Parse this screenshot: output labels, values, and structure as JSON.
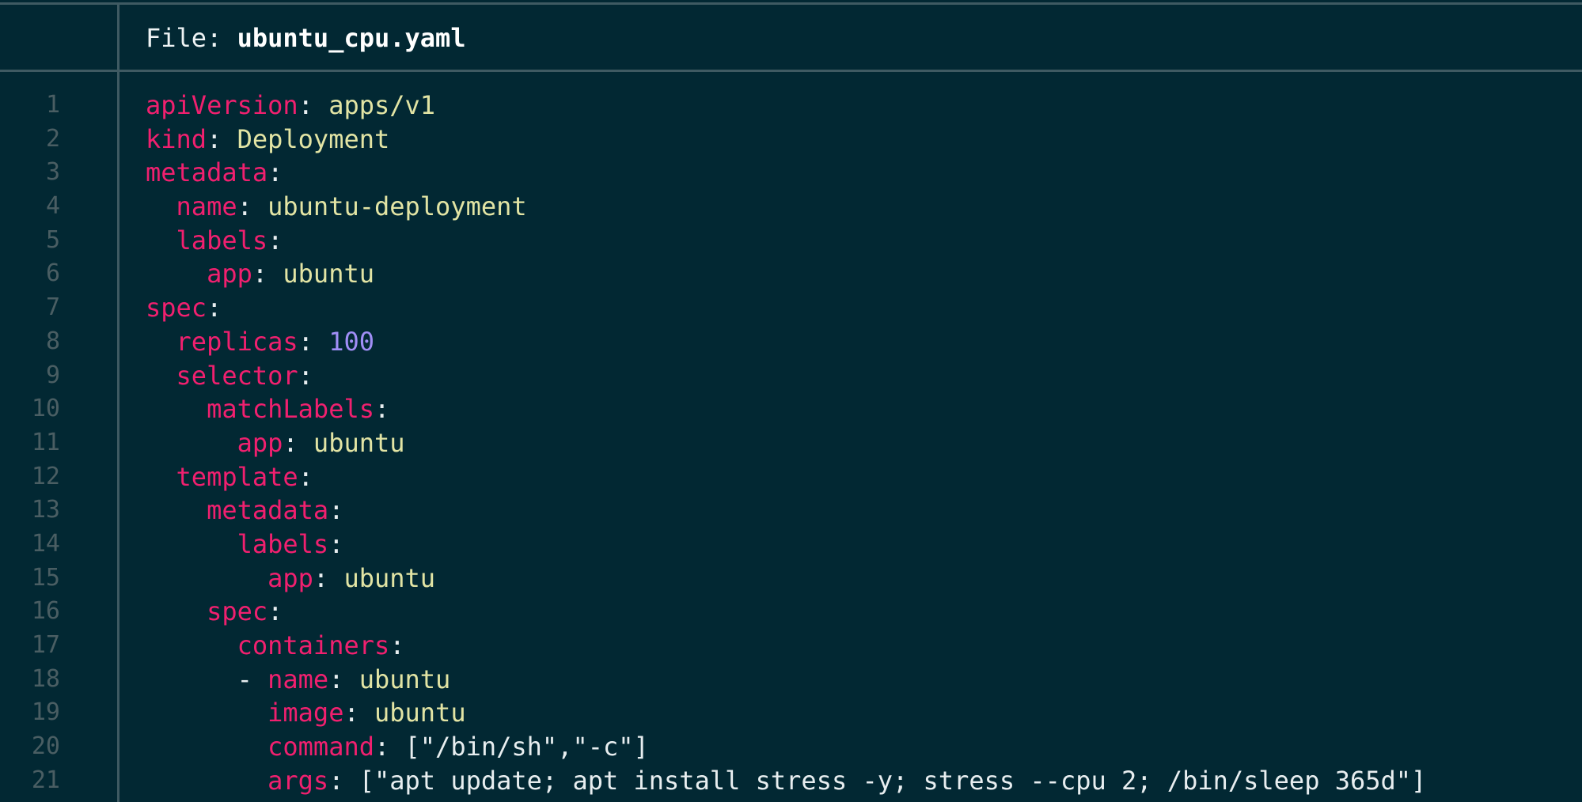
{
  "header": {
    "prefix": "File: ",
    "filename": "ubuntu_cpu.yaml"
  },
  "colors": {
    "background": "#022833",
    "key": "#f0206f",
    "value": "#e2e4a4",
    "number": "#a08ef6",
    "line_number": "#4a5e63",
    "divider": "#3f5a62"
  },
  "lines": [
    {
      "num": "1",
      "indent": "",
      "dash": "",
      "key": "apiVersion",
      "sep": ": ",
      "val": "apps/v1",
      "valType": "s"
    },
    {
      "num": "2",
      "indent": "",
      "dash": "",
      "key": "kind",
      "sep": ": ",
      "val": "Deployment",
      "valType": "s"
    },
    {
      "num": "3",
      "indent": "",
      "dash": "",
      "key": "metadata",
      "sep": ":",
      "val": "",
      "valType": "s"
    },
    {
      "num": "4",
      "indent": "  ",
      "dash": "",
      "key": "name",
      "sep": ": ",
      "val": "ubuntu-deployment",
      "valType": "s"
    },
    {
      "num": "5",
      "indent": "  ",
      "dash": "",
      "key": "labels",
      "sep": ":",
      "val": "",
      "valType": "s"
    },
    {
      "num": "6",
      "indent": "    ",
      "dash": "",
      "key": "app",
      "sep": ": ",
      "val": "ubuntu",
      "valType": "s"
    },
    {
      "num": "7",
      "indent": "",
      "dash": "",
      "key": "spec",
      "sep": ":",
      "val": "",
      "valType": "s"
    },
    {
      "num": "8",
      "indent": "  ",
      "dash": "",
      "key": "replicas",
      "sep": ": ",
      "val": "100",
      "valType": "n"
    },
    {
      "num": "9",
      "indent": "  ",
      "dash": "",
      "key": "selector",
      "sep": ":",
      "val": "",
      "valType": "s"
    },
    {
      "num": "10",
      "indent": "    ",
      "dash": "",
      "key": "matchLabels",
      "sep": ":",
      "val": "",
      "valType": "s"
    },
    {
      "num": "11",
      "indent": "      ",
      "dash": "",
      "key": "app",
      "sep": ": ",
      "val": "ubuntu",
      "valType": "s"
    },
    {
      "num": "12",
      "indent": "  ",
      "dash": "",
      "key": "template",
      "sep": ":",
      "val": "",
      "valType": "s"
    },
    {
      "num": "13",
      "indent": "    ",
      "dash": "",
      "key": "metadata",
      "sep": ":",
      "val": "",
      "valType": "s"
    },
    {
      "num": "14",
      "indent": "      ",
      "dash": "",
      "key": "labels",
      "sep": ":",
      "val": "",
      "valType": "s"
    },
    {
      "num": "15",
      "indent": "        ",
      "dash": "",
      "key": "app",
      "sep": ": ",
      "val": "ubuntu",
      "valType": "s"
    },
    {
      "num": "16",
      "indent": "    ",
      "dash": "",
      "key": "spec",
      "sep": ":",
      "val": "",
      "valType": "s"
    },
    {
      "num": "17",
      "indent": "      ",
      "dash": "",
      "key": "containers",
      "sep": ":",
      "val": "",
      "valType": "s"
    },
    {
      "num": "18",
      "indent": "      ",
      "dash": "- ",
      "key": "name",
      "sep": ": ",
      "val": "ubuntu",
      "valType": "s"
    },
    {
      "num": "19",
      "indent": "        ",
      "dash": "",
      "key": "image",
      "sep": ": ",
      "val": "ubuntu",
      "valType": "s"
    },
    {
      "num": "20",
      "indent": "        ",
      "dash": "",
      "key": "command",
      "sep": ": ",
      "val": "[\"/bin/sh\",\"-c\"]",
      "valType": "p"
    },
    {
      "num": "21",
      "indent": "        ",
      "dash": "",
      "key": "args",
      "sep": ": ",
      "val": "[\"apt update; apt install stress -y; stress --cpu 2; /bin/sleep 365d\"]",
      "valType": "p"
    }
  ]
}
